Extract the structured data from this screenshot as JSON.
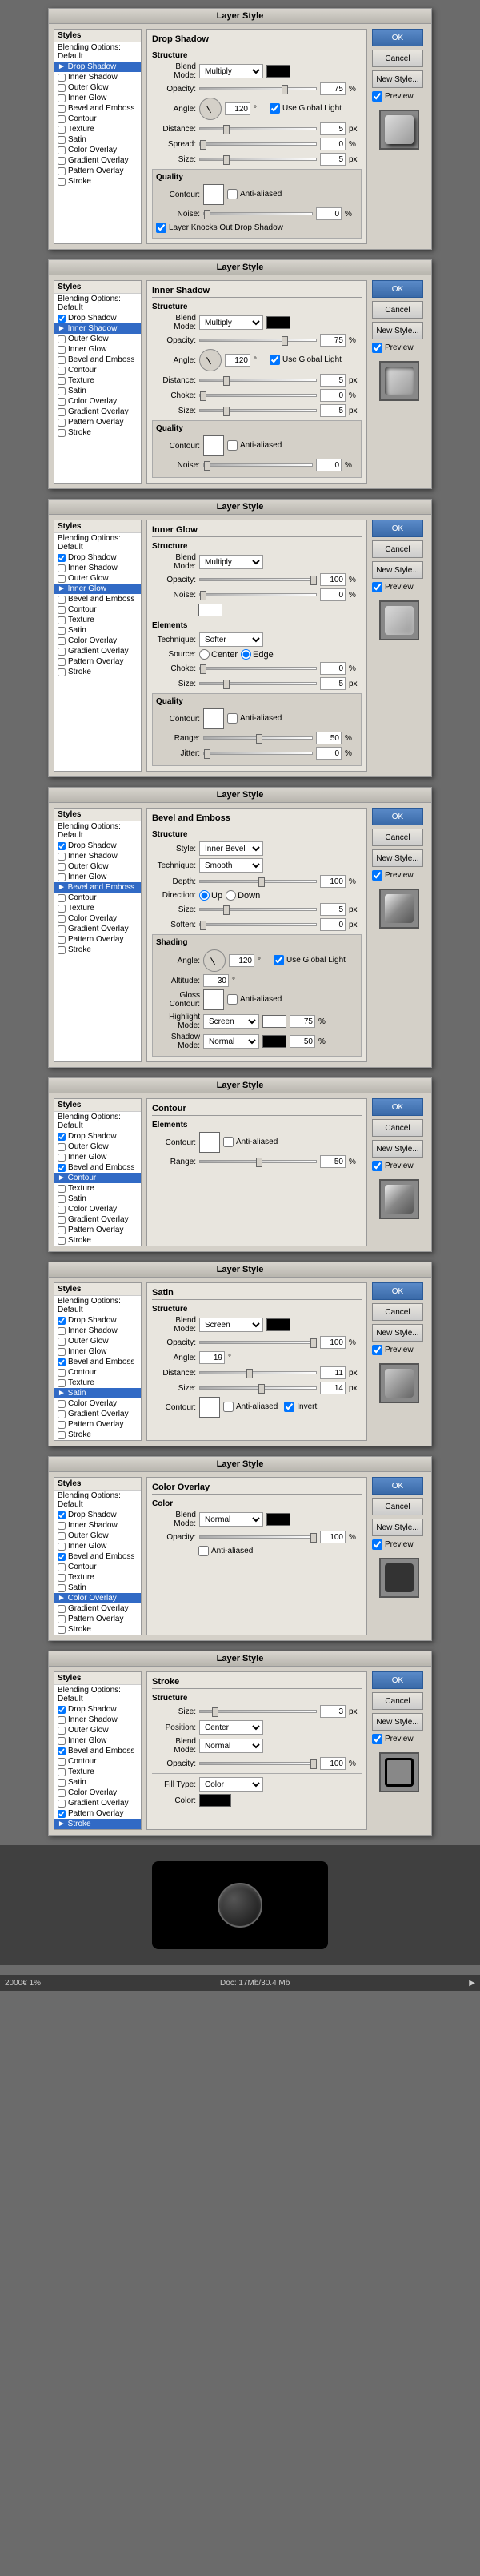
{
  "app": {
    "title": "Layer Style Dialogs"
  },
  "dialogs": [
    {
      "id": "drop-shadow",
      "title": "Layer Style",
      "active_style": "Drop Shadow",
      "styles": [
        {
          "label": "Styles",
          "checkbox": false,
          "type": "header"
        },
        {
          "label": "Blending Options: Default",
          "checkbox": false,
          "active": false
        },
        {
          "label": "Drop Shadow",
          "checkbox": true,
          "active": true
        },
        {
          "label": "Inner Shadow",
          "checkbox": false,
          "active": false
        },
        {
          "label": "Outer Glow",
          "checkbox": false,
          "active": false
        },
        {
          "label": "Inner Glow",
          "checkbox": false,
          "active": false
        },
        {
          "label": "Bevel and Emboss",
          "checkbox": false,
          "active": false
        },
        {
          "label": "Contour",
          "checkbox": false,
          "active": false
        },
        {
          "label": "Texture",
          "checkbox": false,
          "active": false
        },
        {
          "label": "Satin",
          "checkbox": false,
          "active": false
        },
        {
          "label": "Color Overlay",
          "checkbox": false,
          "active": false
        },
        {
          "label": "Gradient Overlay",
          "checkbox": false,
          "active": false
        },
        {
          "label": "Pattern Overlay",
          "checkbox": false,
          "active": false
        },
        {
          "label": "Stroke",
          "checkbox": false,
          "active": false
        }
      ],
      "content_title": "Drop Shadow",
      "structure": {
        "blend_mode": "Multiply",
        "opacity": 75,
        "angle": 120,
        "use_global_light": true,
        "distance": 5,
        "spread": 0,
        "size": 5
      },
      "quality": {
        "contour": "Linear",
        "anti_aliased": false,
        "noise": 0,
        "layer_knocks_out": true
      },
      "buttons": [
        "OK",
        "Cancel",
        "New Style...",
        "Preview"
      ]
    },
    {
      "id": "inner-shadow",
      "title": "Layer Style",
      "active_style": "Inner Shadow",
      "styles": [
        {
          "label": "Styles",
          "checkbox": false,
          "type": "header"
        },
        {
          "label": "Blending Options: Default",
          "checkbox": false,
          "active": false
        },
        {
          "label": "Drop Shadow",
          "checkbox": true,
          "active": false
        },
        {
          "label": "Inner Shadow",
          "checkbox": true,
          "active": true
        },
        {
          "label": "Outer Glow",
          "checkbox": false,
          "active": false
        },
        {
          "label": "Inner Glow",
          "checkbox": false,
          "active": false
        },
        {
          "label": "Bevel and Emboss",
          "checkbox": false,
          "active": false
        },
        {
          "label": "Contour",
          "checkbox": false,
          "active": false
        },
        {
          "label": "Texture",
          "checkbox": false,
          "active": false
        },
        {
          "label": "Satin",
          "checkbox": false,
          "active": false
        },
        {
          "label": "Color Overlay",
          "checkbox": false,
          "active": false
        },
        {
          "label": "Gradient Overlay",
          "checkbox": false,
          "active": false
        },
        {
          "label": "Pattern Overlay",
          "checkbox": false,
          "active": false
        },
        {
          "label": "Stroke",
          "checkbox": false,
          "active": false
        }
      ],
      "content_title": "Inner Shadow",
      "structure": {
        "blend_mode": "Multiply",
        "opacity": 75,
        "angle": 120,
        "use_global_light": true,
        "distance": 5,
        "choke": 0,
        "size": 5
      },
      "quality": {
        "contour": "Linear",
        "anti_aliased": false,
        "noise": 0
      },
      "buttons": [
        "OK",
        "Cancel",
        "New Style...",
        "Preview"
      ]
    },
    {
      "id": "inner-glow",
      "title": "Layer Style",
      "active_style": "Inner Glow",
      "styles": [
        {
          "label": "Styles",
          "checkbox": false,
          "type": "header"
        },
        {
          "label": "Blending Options: Default",
          "checkbox": false,
          "active": false
        },
        {
          "label": "Drop Shadow",
          "checkbox": true,
          "active": false
        },
        {
          "label": "Inner Shadow",
          "checkbox": false,
          "active": false
        },
        {
          "label": "Outer Glow",
          "checkbox": false,
          "active": false
        },
        {
          "label": "Inner Glow",
          "checkbox": true,
          "active": true
        },
        {
          "label": "Bevel and Emboss",
          "checkbox": false,
          "active": false
        },
        {
          "label": "Contour",
          "checkbox": false,
          "active": false
        },
        {
          "label": "Texture",
          "checkbox": false,
          "active": false
        },
        {
          "label": "Satin",
          "checkbox": false,
          "active": false
        },
        {
          "label": "Color Overlay",
          "checkbox": false,
          "active": false
        },
        {
          "label": "Gradient Overlay",
          "checkbox": false,
          "active": false
        },
        {
          "label": "Pattern Overlay",
          "checkbox": false,
          "active": false
        },
        {
          "label": "Stroke",
          "checkbox": false,
          "active": false
        }
      ],
      "content_title": "Inner Glow",
      "structure": {
        "blend_mode": "Multiply",
        "opacity": 100,
        "noise": 0
      },
      "elements": {
        "technique": "Softer",
        "source_center": true,
        "source_edge": false,
        "choke": 0,
        "size": 5
      },
      "quality": {
        "contour": "Linear",
        "anti_aliased": false,
        "range": 50,
        "jitter": 0
      },
      "buttons": [
        "OK",
        "Cancel",
        "New Style...",
        "Preview"
      ]
    },
    {
      "id": "bevel-emboss",
      "title": "Layer Style",
      "active_style": "Bevel and Emboss",
      "styles": [
        {
          "label": "Styles",
          "checkbox": false,
          "type": "header"
        },
        {
          "label": "Blending Options: Default",
          "checkbox": false,
          "active": false
        },
        {
          "label": "Drop Shadow",
          "checkbox": true,
          "active": false
        },
        {
          "label": "Inner Shadow",
          "checkbox": false,
          "active": false
        },
        {
          "label": "Outer Glow",
          "checkbox": false,
          "active": false
        },
        {
          "label": "Inner Glow",
          "checkbox": false,
          "active": false
        },
        {
          "label": "Bevel and Emboss",
          "checkbox": true,
          "active": true
        },
        {
          "label": "Contour",
          "checkbox": false,
          "active": false
        },
        {
          "label": "Texture",
          "checkbox": false,
          "active": false
        },
        {
          "label": "Color Overlay",
          "checkbox": false,
          "active": false
        },
        {
          "label": "Gradient Overlay",
          "checkbox": false,
          "active": false
        },
        {
          "label": "Pattern Overlay",
          "checkbox": false,
          "active": false
        },
        {
          "label": "Stroke",
          "checkbox": false,
          "active": false
        }
      ],
      "content_title": "Bevel and Emboss",
      "structure": {
        "style": "Inner Bevel",
        "technique": "Smooth",
        "depth": 100,
        "direction_up": true,
        "direction_down": false,
        "size": 5,
        "soften": 0
      },
      "shading": {
        "angle": 120,
        "use_global_light": true,
        "altitude": 30,
        "gloss_contour": "Linear",
        "anti_aliased": false,
        "highlight_mode": "Screen",
        "highlight_opacity": 75,
        "shadow_mode": "Normal",
        "shadow_opacity": 50
      },
      "buttons": [
        "OK",
        "Cancel",
        "New Style...",
        "Preview"
      ]
    },
    {
      "id": "contour",
      "title": "Layer Style",
      "active_style": "Contour",
      "styles": [
        {
          "label": "Styles",
          "checkbox": false,
          "type": "header"
        },
        {
          "label": "Blending Options: Default",
          "checkbox": false,
          "active": false
        },
        {
          "label": "Drop Shadow",
          "checkbox": true,
          "active": false
        },
        {
          "label": "Outer Glow",
          "checkbox": false,
          "active": false
        },
        {
          "label": "Inner Glow",
          "checkbox": false,
          "active": false
        },
        {
          "label": "Bevel and Emboss",
          "checkbox": true,
          "active": false
        },
        {
          "label": "Contour",
          "checkbox": true,
          "active": true
        },
        {
          "label": "Texture",
          "checkbox": false,
          "active": false
        },
        {
          "label": "Satin",
          "checkbox": false,
          "active": false
        },
        {
          "label": "Color Overlay",
          "checkbox": false,
          "active": false
        },
        {
          "label": "Gradient Overlay",
          "checkbox": false,
          "active": false
        },
        {
          "label": "Pattern Overlay",
          "checkbox": false,
          "active": false
        },
        {
          "label": "Stroke",
          "checkbox": false,
          "active": false
        }
      ],
      "content_title": "Contour",
      "elements": {
        "contour": "Linear",
        "anti_aliased": false,
        "range": 50
      },
      "buttons": [
        "OK",
        "Cancel",
        "New Style...",
        "Preview"
      ]
    },
    {
      "id": "satin",
      "title": "Layer Style",
      "active_style": "Satin",
      "styles": [
        {
          "label": "Styles",
          "checkbox": false,
          "type": "header"
        },
        {
          "label": "Blending Options: Default",
          "checkbox": false,
          "active": false
        },
        {
          "label": "Drop Shadow",
          "checkbox": true,
          "active": false
        },
        {
          "label": "Inner Shadow",
          "checkbox": false,
          "active": false
        },
        {
          "label": "Outer Glow",
          "checkbox": false,
          "active": false
        },
        {
          "label": "Inner Glow",
          "checkbox": false,
          "active": false
        },
        {
          "label": "Bevel and Emboss",
          "checkbox": true,
          "active": false
        },
        {
          "label": "Contour",
          "checkbox": false,
          "active": false
        },
        {
          "label": "Texture",
          "checkbox": false,
          "active": false
        },
        {
          "label": "Satin",
          "checkbox": true,
          "active": true
        },
        {
          "label": "Color Overlay",
          "checkbox": false,
          "active": false
        },
        {
          "label": "Gradient Overlay",
          "checkbox": false,
          "active": false
        },
        {
          "label": "Pattern Overlay",
          "checkbox": false,
          "active": false
        },
        {
          "label": "Stroke",
          "checkbox": false,
          "active": false
        }
      ],
      "content_title": "Satin",
      "structure": {
        "blend_mode": "Screen",
        "color": "#000000",
        "opacity": 100,
        "angle": 19,
        "distance": 11,
        "size": 14,
        "contour": "Linear",
        "invert": true,
        "anti_aliased": false
      },
      "buttons": [
        "OK",
        "Cancel",
        "New Style...",
        "Preview"
      ]
    },
    {
      "id": "color-overlay",
      "title": "Layer Style",
      "active_style": "Color Overlay",
      "styles": [
        {
          "label": "Styles",
          "checkbox": false,
          "type": "header"
        },
        {
          "label": "Blending Options: Default",
          "checkbox": false,
          "active": false
        },
        {
          "label": "Drop Shadow",
          "checkbox": true,
          "active": false
        },
        {
          "label": "Inner Shadow",
          "checkbox": false,
          "active": false
        },
        {
          "label": "Outer Glow",
          "checkbox": false,
          "active": false
        },
        {
          "label": "Inner Glow",
          "checkbox": false,
          "active": false
        },
        {
          "label": "Bevel and Emboss",
          "checkbox": true,
          "active": false
        },
        {
          "label": "Contour",
          "checkbox": false,
          "active": false
        },
        {
          "label": "Texture",
          "checkbox": false,
          "active": false
        },
        {
          "label": "Satin",
          "checkbox": false,
          "active": false
        },
        {
          "label": "Color Overlay",
          "checkbox": true,
          "active": true
        },
        {
          "label": "Gradient Overlay",
          "checkbox": false,
          "active": false
        },
        {
          "label": "Pattern Overlay",
          "checkbox": false,
          "active": false
        },
        {
          "label": "Stroke",
          "checkbox": false,
          "active": false
        }
      ],
      "content_title": "Color Overlay",
      "structure": {
        "blend_mode": "Normal",
        "color": "#000000",
        "opacity": 100
      },
      "quality": {
        "anti_aliased": false
      },
      "buttons": [
        "OK",
        "Cancel",
        "New Style...",
        "Preview"
      ]
    },
    {
      "id": "stroke",
      "title": "Layer Style",
      "active_style": "Stroke",
      "styles": [
        {
          "label": "Styles",
          "checkbox": false,
          "type": "header"
        },
        {
          "label": "Blending Options: Default",
          "checkbox": false,
          "active": false
        },
        {
          "label": "Drop Shadow",
          "checkbox": true,
          "active": false
        },
        {
          "label": "Inner Shadow",
          "checkbox": false,
          "active": false
        },
        {
          "label": "Outer Glow",
          "checkbox": false,
          "active": false
        },
        {
          "label": "Inner Glow",
          "checkbox": false,
          "active": false
        },
        {
          "label": "Bevel and Emboss",
          "checkbox": true,
          "active": false
        },
        {
          "label": "Contour",
          "checkbox": false,
          "active": false
        },
        {
          "label": "Texture",
          "checkbox": false,
          "active": false
        },
        {
          "label": "Satin",
          "checkbox": false,
          "active": false
        },
        {
          "label": "Color Overlay",
          "checkbox": false,
          "active": false
        },
        {
          "label": "Gradient Overlay",
          "checkbox": false,
          "active": false
        },
        {
          "label": "Pattern Overlay",
          "checkbox": true,
          "active": false
        },
        {
          "label": "Stroke",
          "checkbox": true,
          "active": true
        }
      ],
      "content_title": "Stroke",
      "structure": {
        "size": 3,
        "position": "Center",
        "blend_mode": "Normal",
        "opacity": 100,
        "fill_type": "Color",
        "color": "#000000"
      },
      "buttons": [
        "OK",
        "Cancel",
        "New Style...",
        "Preview"
      ]
    }
  ],
  "buttons": {
    "ok": "OK",
    "cancel": "Cancel",
    "new_style": "New Style...",
    "preview": "Preview"
  },
  "bottombar": {
    "left": "2000€ 1%",
    "middle": "Doc: 17Mb/30.4 Mb",
    "right": ""
  }
}
